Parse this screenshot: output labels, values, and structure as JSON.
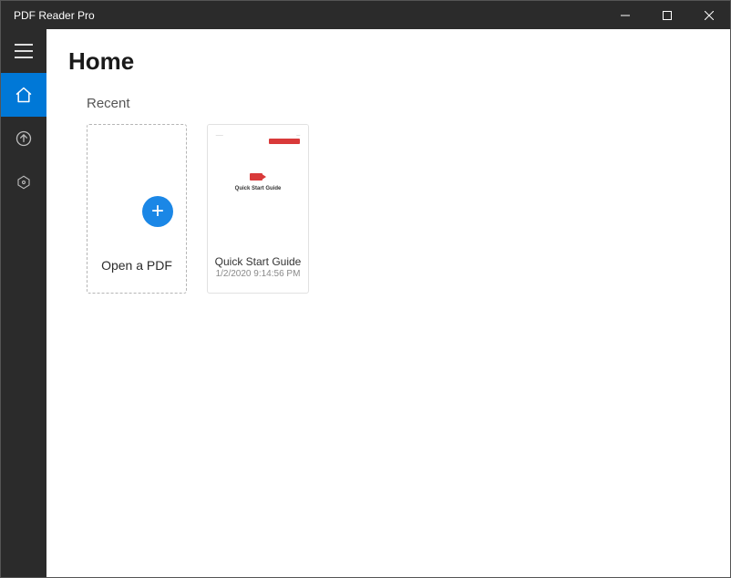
{
  "window": {
    "title": "PDF Reader Pro"
  },
  "page": {
    "title": "Home"
  },
  "section": {
    "recent_label": "Recent"
  },
  "open": {
    "label": "Open a PDF"
  },
  "recent": [
    {
      "preview_title": "Quick Start Guide",
      "name": "Quick Start Guide",
      "date": "1/2/2020 9:14:56 PM"
    }
  ]
}
